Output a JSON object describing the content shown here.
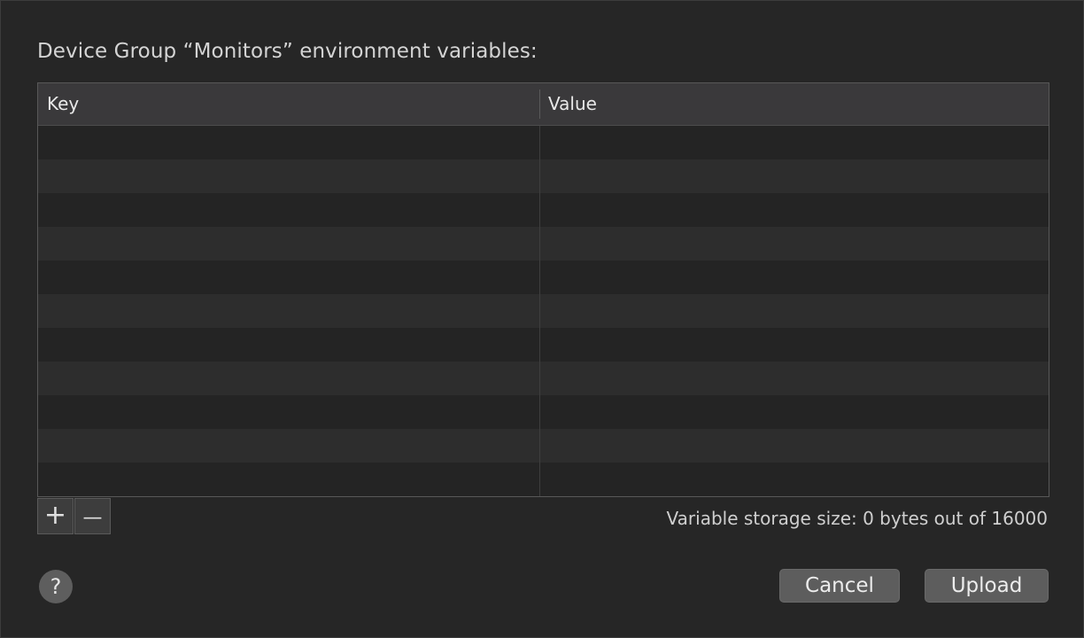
{
  "dialog": {
    "title": "Device Group “Monitors” environment variables:"
  },
  "table": {
    "columns": [
      "Key",
      "Value"
    ],
    "rows": []
  },
  "controls": {
    "add_label": "+",
    "add_icon": "plus-icon",
    "remove_label": "—",
    "remove_icon": "minus-icon",
    "storage_text": "Variable storage size: 0 bytes out of 16000"
  },
  "footer": {
    "help_label": "?",
    "cancel_label": "Cancel",
    "upload_label": "Upload"
  }
}
